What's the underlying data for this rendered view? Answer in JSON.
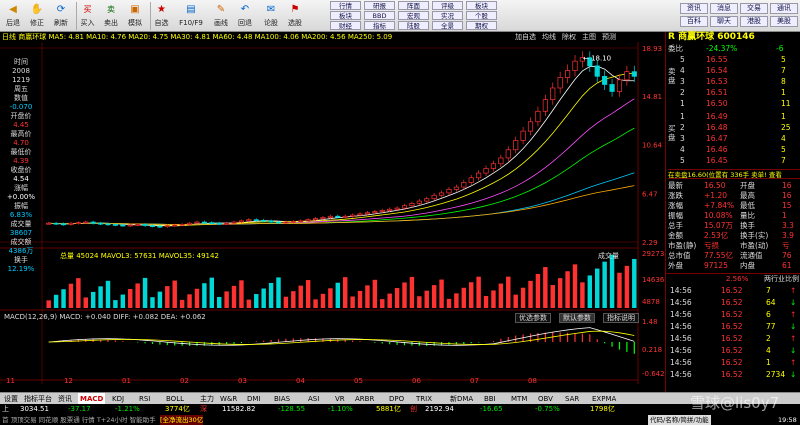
{
  "toolbar": {
    "items": [
      "后退",
      "修正",
      "刷新",
      "买入",
      "卖出",
      "模拟",
      "自选",
      "F10/F9",
      "画线",
      "回退",
      "论股",
      "选股"
    ],
    "quick": [
      [
        "行情",
        "板块",
        "财经",
        "全景",
        "资讯"
      ],
      [
        "研报",
        "BBD",
        "指标",
        "沪伦",
        "热点"
      ],
      [
        "阵面",
        "宏观",
        "陆股",
        "龙虎",
        "跟踪"
      ],
      [
        "评级",
        "实况",
        "全景",
        "发言",
        "提醒"
      ],
      [
        "板块",
        "个股",
        "期权",
        "外汇",
        "更多"
      ]
    ],
    "right": [
      [
        "资讯",
        "消息",
        "交易",
        "通讯"
      ],
      [
        "百科",
        "聊天",
        "港股",
        "美股"
      ]
    ]
  },
  "subtabs": {
    "left": "日线 商赢环球 MA5: 4.81 MA10: 4.76 MA20: 4.75 MA30: 4.81 MA60: 4.48 MA100: 4.06 MA200: 4.56 MA250: 5.09",
    "right": [
      "加自选",
      "均线",
      "除权",
      "主图",
      "预测"
    ]
  },
  "chart_data": {
    "type": "line",
    "title": "商赢环球 600146",
    "price_axis": [
      18.93,
      14.81,
      10.64,
      6.47,
      2.29
    ],
    "volume_axis": [
      29273,
      14636,
      4878
    ],
    "macd_axis": [
      1.48,
      0.218,
      -0.642
    ],
    "months": [
      "11",
      "12",
      "01",
      "02",
      "03",
      "04",
      "05",
      "06",
      "07",
      "08"
    ],
    "close": [
      3.9,
      3.85,
      3.8,
      3.9,
      3.95,
      4.0,
      3.9,
      3.85,
      3.8,
      3.75,
      3.7,
      3.75,
      3.8,
      3.7,
      3.65,
      3.6,
      3.7,
      3.75,
      3.8,
      3.9,
      4.0,
      3.95,
      3.9,
      3.85,
      3.9,
      4.0,
      4.1,
      4.2,
      4.15,
      4.1,
      4.0,
      3.95,
      4.0,
      4.05,
      4.1,
      4.2,
      4.3,
      4.4,
      4.5,
      4.45,
      4.5,
      4.6,
      4.7,
      4.8,
      4.9,
      5.0,
      5.1,
      5.2,
      5.4,
      5.6,
      5.8,
      6.0,
      6.3,
      6.5,
      6.8,
      7.0,
      7.4,
      7.8,
      8.2,
      8.6,
      9.0,
      9.5,
      10.2,
      11.0,
      11.8,
      12.6,
      13.5,
      14.5,
      15.5,
      16.4,
      17.0,
      17.8,
      18.1,
      17.4,
      16.5,
      15.8,
      15.2,
      16.2,
      16.9,
      16.5
    ],
    "annotations": [
      "18.10"
    ]
  },
  "left_labels": [
    "时间",
    "2008",
    "1219",
    "周五",
    "数值",
    "-0.070",
    "开盘价",
    "4.45",
    "最高价",
    "4.70",
    "最低价",
    "4.39",
    "收盘价",
    "4.54",
    "涨幅",
    "+0.00%",
    "振幅",
    "6.83%",
    "成交量",
    "38607",
    "成交额",
    "4386万",
    "换手",
    "12.19%"
  ],
  "vol_legend": "总量 45024 MAVOL3: 57631 MAVOL35: 49142",
  "vol_button": "成交量",
  "macd_legend": "MACD(12,26,9) MACD: +0.040 DIFF: +0.082 DEA: +0.062",
  "macd_buttons": [
    "优选参数",
    "默认参数",
    "指标说明"
  ],
  "rpanel": {
    "title": "R 商赢环球 600146",
    "webi": [
      "委比",
      "-24.37%",
      "-6"
    ],
    "sell": [
      [
        "5",
        "16.55",
        "5"
      ],
      [
        "4",
        "16.54",
        "7"
      ],
      [
        "3",
        "16.53",
        "8"
      ],
      [
        "2",
        "16.51",
        "1"
      ],
      [
        "1",
        "16.50",
        "11"
      ]
    ],
    "buy": [
      [
        "1",
        "16.49",
        "1"
      ],
      [
        "2",
        "16.48",
        "25"
      ],
      [
        "3",
        "16.47",
        "4"
      ],
      [
        "4",
        "16.46",
        "5"
      ],
      [
        "5",
        "16.45",
        "7"
      ]
    ],
    "rec": "在卖盘16.60(位置有 336手 卖单! 查看",
    "stats": [
      [
        "最新",
        "16.50",
        "开盘",
        "16"
      ],
      [
        "涨跌",
        "+1.20",
        "最高",
        "16"
      ],
      [
        "涨幅",
        "+7.84%",
        "最低",
        "15"
      ],
      [
        "振幅",
        "10.08%",
        "量比",
        "1"
      ],
      [
        "总手",
        "15.07万",
        "换手",
        "3.3"
      ],
      [
        "金额",
        "2.53亿",
        "换手(实)",
        "3.9"
      ],
      [
        "市盈(静)",
        "亏损",
        "市盈(动)",
        "亏"
      ],
      [
        "总市值",
        "77.55亿",
        "流通值",
        "76"
      ],
      [
        "外盘",
        "97125",
        "内盘",
        "61"
      ]
    ],
    "ratio": [
      "",
      "2.56%",
      "",
      "两行业比例"
    ],
    "ticks": [
      [
        "14:56",
        "16.52",
        "7"
      ],
      [
        "14:56",
        "16.52",
        "64"
      ],
      [
        "14:56",
        "16.52",
        "6"
      ],
      [
        "14:56",
        "16.52",
        "77"
      ],
      [
        "14:56",
        "16.52",
        "2"
      ],
      [
        "14:56",
        "16.52",
        "4"
      ],
      [
        "14:56",
        "16.52",
        "1"
      ],
      [
        "14:56",
        "16.52",
        "2734"
      ]
    ]
  },
  "bottom_tabs": [
    "设置",
    "指标平台",
    "资讯",
    "MACD",
    "KDJ",
    "RSI",
    "BOLL",
    "主力",
    "W&R",
    "DMI",
    "BIAS",
    "ASI",
    "VR",
    "ARBR",
    "DPO",
    "TRIX",
    "新DMA",
    "BBI",
    "MTM",
    "OBV",
    "SAR",
    "EXPMA"
  ],
  "index_bar": {
    "sh": "3034.51",
    "sh_chg": "-37.17",
    "sh_pct": "-1.21%",
    "sh_amt": "3774亿",
    "sz_label": "深",
    "sz": "11582.82",
    "sz_chg": "-128.55",
    "sz_pct": "-1.10%",
    "sz_amt": "5881亿",
    "cy_label": "创",
    "cy": "2192.94",
    "cy_chg": "-16.65",
    "cy_pct": "-0.75%",
    "cy_amt": "1798亿"
  },
  "status": {
    "left": "首  顶顶交易  同花顺  股票通  行情  T+24小时  智能助手",
    "alert": "[全净流出30亿",
    "right": "代码/名称/简拼/功能",
    "time": "19:58",
    "watermark": "雪球@lis0y7"
  }
}
